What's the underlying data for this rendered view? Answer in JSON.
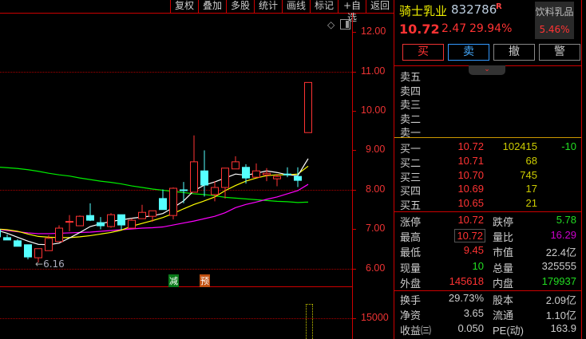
{
  "toolbar": {
    "items": [
      "复权",
      "叠加",
      "多股",
      "统计",
      "画线",
      "标记",
      "+自选",
      "返回"
    ]
  },
  "price_axis": {
    "labels": [
      "12.00",
      "11.00",
      "10.00",
      "9.00",
      "8.00",
      "7.00",
      "6.00"
    ],
    "volume_label": "15000"
  },
  "chart_annotations": {
    "low_label": "6.16",
    "arrow": "←",
    "marker_reduce": "减",
    "marker_forecast": "预"
  },
  "stock": {
    "name": "骑士乳业",
    "code": "832786",
    "flag": "R",
    "price": "10.72",
    "change": "2.47",
    "change_pct": "29.94%",
    "sector": "饮料乳品",
    "sector_pct": "5.46%"
  },
  "actions": {
    "buy": "买",
    "sell": "卖",
    "cancel": "撤",
    "alert": "警"
  },
  "sell_levels": [
    {
      "label": "卖五"
    },
    {
      "label": "卖四"
    },
    {
      "label": "卖三"
    },
    {
      "label": "卖二"
    },
    {
      "label": "卖一"
    }
  ],
  "buy_levels": [
    {
      "label": "买一",
      "price": "10.72",
      "vol": "102415",
      "chg": "-10"
    },
    {
      "label": "买二",
      "price": "10.71",
      "vol": "68",
      "chg": ""
    },
    {
      "label": "买三",
      "price": "10.70",
      "vol": "745",
      "chg": ""
    },
    {
      "label": "买四",
      "price": "10.69",
      "vol": "17",
      "chg": ""
    },
    {
      "label": "买五",
      "price": "10.65",
      "vol": "21",
      "chg": ""
    }
  ],
  "stats": [
    {
      "l1": "涨停",
      "v1": "10.72",
      "l2": "跌停",
      "v2": "5.78"
    },
    {
      "l1": "最高",
      "v1": "10.72",
      "l2": "量比",
      "v2": "16.29"
    },
    {
      "l1": "最低",
      "v1": "9.45",
      "l2": "市值",
      "v2": "22.4亿"
    },
    {
      "l1": "现量",
      "v1": "10",
      "l2": "总量",
      "v2": "325555"
    },
    {
      "l1": "外盘",
      "v1": "145618",
      "l2": "内盘",
      "v2": "179937"
    }
  ],
  "fin": [
    {
      "l1": "换手",
      "v1": "29.73%",
      "l2": "股本",
      "v2": "2.09亿"
    },
    {
      "l1": "净资",
      "v1": "3.65",
      "l2": "流通",
      "v2": "1.10亿"
    },
    {
      "l1": "收益㈢",
      "v1": "0.050",
      "l2": "PE(动)",
      "v2": "163.9"
    }
  ],
  "colors": {
    "up": "#ff3333",
    "down": "#55ffff",
    "ma5": "#ffffff",
    "ma10": "#ffff00",
    "ma20": "#ff00ff",
    "ma60": "#00ee00"
  },
  "chart_data": {
    "type": "candlestick",
    "ylim": [
      6,
      12
    ],
    "ohlc": [
      [
        6.99,
        6.99,
        6.81,
        6.81
      ],
      [
        6.79,
        6.87,
        6.73,
        6.73
      ],
      [
        6.71,
        6.75,
        6.57,
        6.57
      ],
      [
        6.61,
        6.61,
        6.24,
        6.3
      ],
      [
        6.28,
        6.51,
        6.16,
        6.51
      ],
      [
        6.46,
        6.85,
        6.46,
        6.77
      ],
      [
        6.69,
        7.1,
        6.69,
        7.03
      ],
      [
        7.18,
        7.36,
        6.95,
        7.2
      ],
      [
        7.09,
        7.35,
        7.09,
        7.33
      ],
      [
        7.35,
        7.66,
        7.21,
        7.23
      ],
      [
        7.17,
        7.31,
        7.0,
        7.09
      ],
      [
        7.07,
        7.41,
        7.04,
        7.37
      ],
      [
        7.37,
        7.37,
        6.99,
        7.11
      ],
      [
        7.03,
        7.28,
        7.03,
        7.23
      ],
      [
        7.27,
        7.62,
        7.27,
        7.43
      ],
      [
        7.33,
        7.47,
        7.19,
        7.47
      ],
      [
        7.78,
        8.01,
        7.5,
        7.5
      ],
      [
        7.35,
        8.06,
        7.25,
        8.04
      ],
      [
        8.0,
        8.2,
        7.66,
        7.98
      ],
      [
        7.94,
        9.38,
        7.94,
        8.71
      ],
      [
        8.48,
        9.0,
        7.83,
        8.12
      ],
      [
        7.88,
        8.22,
        7.71,
        8.06
      ],
      [
        8.06,
        8.55,
        7.78,
        8.55
      ],
      [
        8.53,
        8.85,
        8.53,
        8.71
      ],
      [
        8.57,
        8.65,
        8.16,
        8.3
      ],
      [
        8.32,
        8.67,
        8.32,
        8.48
      ],
      [
        8.38,
        8.55,
        8.22,
        8.42
      ],
      [
        8.28,
        8.4,
        8.09,
        8.34
      ],
      [
        8.4,
        8.57,
        8.32,
        8.38
      ],
      [
        8.34,
        8.57,
        8.07,
        8.24
      ],
      [
        9.45,
        10.72,
        9.45,
        10.72
      ]
    ],
    "ma5": [
      6.98,
      6.9,
      6.8,
      6.7,
      6.62,
      6.61,
      6.65,
      6.78,
      6.92,
      7.07,
      7.14,
      7.2,
      7.24,
      7.28,
      7.31,
      7.34,
      7.4,
      7.55,
      7.72,
      7.98,
      8.12,
      8.2,
      8.3,
      8.4,
      8.37,
      8.42,
      8.48,
      8.44,
      8.38,
      8.36,
      8.79
    ],
    "ma10": [
      7.01,
      6.99,
      6.95,
      6.88,
      6.82,
      6.8,
      6.79,
      6.79,
      6.81,
      6.84,
      6.88,
      6.92,
      6.98,
      7.08,
      7.15,
      7.22,
      7.3,
      7.4,
      7.52,
      7.63,
      7.72,
      7.82,
      7.98,
      8.11,
      8.22,
      8.3,
      8.36,
      8.38,
      8.38,
      8.4,
      8.6
    ],
    "ma20": [
      7.0,
      6.97,
      6.94,
      6.91,
      6.89,
      6.89,
      6.9,
      6.91,
      6.92,
      6.93,
      6.95,
      6.97,
      6.99,
      7.01,
      7.03,
      7.04,
      7.06,
      7.11,
      7.16,
      7.21,
      7.27,
      7.33,
      7.42,
      7.55,
      7.63,
      7.69,
      7.76,
      7.82,
      7.9,
      7.98,
      8.14
    ],
    "ma60": [
      8.58,
      8.56,
      8.54,
      8.51,
      8.47,
      8.42,
      8.38,
      8.35,
      8.3,
      8.26,
      8.22,
      8.19,
      8.15,
      8.1,
      8.06,
      8.02,
      7.99,
      7.96,
      7.93,
      7.9,
      7.88,
      7.85,
      7.81,
      7.79,
      7.77,
      7.75,
      7.73,
      7.71,
      7.7,
      7.68,
      7.69
    ]
  }
}
